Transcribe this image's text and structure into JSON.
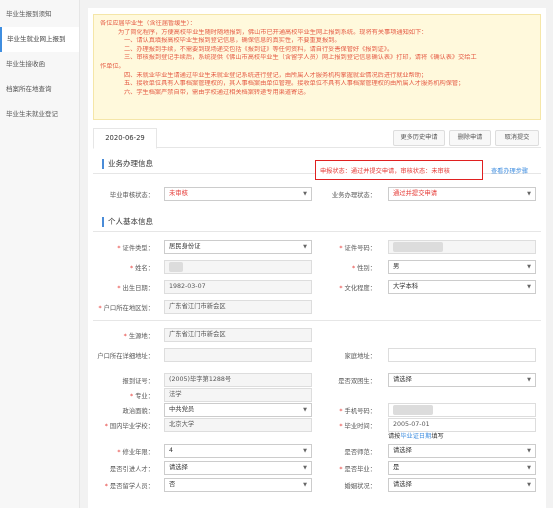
{
  "sidebar": {
    "items": [
      {
        "label": "毕业生报到须知"
      },
      {
        "label": "毕业生就业网上报到"
      },
      {
        "label": "毕业生接收函"
      },
      {
        "label": "档案所在地查询"
      },
      {
        "label": "毕业生未就业登记"
      }
    ],
    "active_index": 1
  },
  "notice": {
    "lines": [
      "各位应届毕业生（含往届暂缓生）：",
      "为了简化程序，方便高校毕业生随时随地报到，佛山市已开通高校毕业生网上报到系统。现将有关事项通知如下：",
      "一、请认真填报高校毕业生报到登记信息，确保信息的真实性，不要重复报到。",
      "二、办理报到手续，不需要到现场递交包括《报到证》等任何资料，请自行妥善保管好《报到证》。",
      "三、审核报到登记手续后，系统提供《佛山市高校毕业生（含留学人员）网上报到登记信息确认表》打印，请将《确认表》交给工",
      "作单位。",
      "四、未就业毕业生请通过毕业生未就业登记系统进行登记，由所属人才服务机构掌握就业情况后进行就业帮助；",
      "五、接收单位具有人事档案管理权的，其人事档案由单位管理。接收单位不具有人事档案管理权的由所属人才服务机构保管；",
      "六、学生档案严禁自带，需由学校通过相关档案转递专用渠道寄送。"
    ]
  },
  "tabs": {
    "date": "2020-06-29",
    "buttons": [
      "更多历史申请",
      "删除申请",
      "取消提交"
    ]
  },
  "business": {
    "title": "业务办理信息",
    "status_text": "申报状态：通过并提交申请，审核状态：未审核",
    "help_link": "查看办理步骤",
    "audit_label": "毕业审核状态：",
    "audit_value": "未审核",
    "handle_label": "业务办理状态：",
    "handle_value": "通过并提交申请"
  },
  "personal": {
    "title": "个人基本信息",
    "id_type_label": "证件类型：",
    "id_type_value": "居民身份证",
    "id_no_label": "证件号码：",
    "name_label": "姓名：",
    "gender_label": "性别：",
    "gender_value": "男",
    "birth_label": "出生日期：",
    "birth_value": "1982-03-07",
    "edu_label": "文化程度：",
    "edu_value": "大学本科",
    "hukou_label": "户口所在地区划：",
    "hukou_value": "广东省江门市新会区",
    "origin_label": "生源地：",
    "origin_value": "广东省江门市新会区",
    "hukou_addr_label": "户口所在详细地址：",
    "home_addr_label": "家庭地址：",
    "report_no_label": "报到证号：",
    "report_no_value": "(2005)毕字第1288号",
    "double_label": "是否双困生：",
    "double_value": "请选择",
    "major_label": "专业：",
    "major_value": "法学",
    "politics_label": "政治面貌：",
    "politics_value": "中共党员",
    "phone_label": "手机号码：",
    "school_label": "国内毕业学校：",
    "school_value": "北京大学",
    "grad_label": "毕业时间：",
    "grad_value": "2005-07-01",
    "grad_hint_pre": "请按",
    "grad_hint_link": "毕业证日期",
    "grad_hint_post": "填写",
    "years_label": "修业年限：",
    "years_value": "4",
    "normal_label": "是否师范：",
    "normal_value": "请选择",
    "talent_label": "是否引进人才：",
    "talent_value": "请选择",
    "graduated_label": "是否毕业：",
    "graduated_value": "是",
    "abroad_label": "是否留学人员：",
    "abroad_value": "否",
    "marital_label": "婚姻状况：",
    "marital_value": "请选择"
  },
  "colors": {
    "accent": "#3f8ee0",
    "alert": "#e53935",
    "notice_bg": "#fff9dc"
  }
}
